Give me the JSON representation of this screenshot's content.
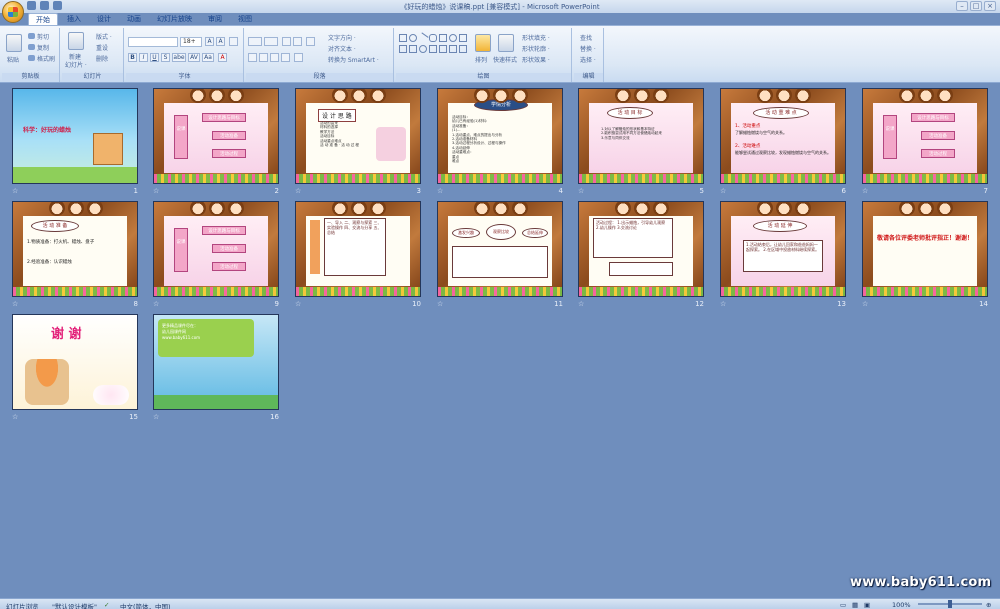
{
  "window": {
    "title": "《好玩的蜡烛》说课稿.ppt [兼容模式] - Microsoft PowerPoint",
    "controls": [
      "–",
      "□",
      "×"
    ]
  },
  "tabs": [
    "开始",
    "插入",
    "设计",
    "动画",
    "幻灯片放映",
    "审阅",
    "视图"
  ],
  "ribbon": {
    "clipboard": {
      "label": "剪贴板",
      "paste": "粘贴",
      "cut": "剪切",
      "copy": "复制",
      "format_painter": "格式刷"
    },
    "slides": {
      "label": "幻灯片",
      "new_slide": "新建",
      "new_slide2": "幻灯片 ·",
      "layout": "版式 ·",
      "reset": "重设",
      "delete": "删除"
    },
    "font": {
      "label": "字体",
      "size": "18+",
      "bold": "B",
      "italic": "I",
      "underline": "U",
      "strike": "S",
      "shadow": "abe",
      "spacing": "AV",
      "case": "Aa",
      "color": "A",
      "grow": "A",
      "shrink": "A"
    },
    "paragraph": {
      "label": "段落",
      "text_direction": "文字方向 ·",
      "align_text": "对齐文本 ·",
      "smartart": "转换为 SmartArt ·"
    },
    "drawing": {
      "label": "绘图",
      "arrange": "排列",
      "quick_styles": "快速样式",
      "fill": "形状填充 ·",
      "outline": "形状轮廓 ·",
      "effects": "形状效果 ·"
    },
    "editing": {
      "label": "编辑",
      "find": "查找",
      "replace": "替换 ·",
      "select": "选择 ·"
    }
  },
  "slides": [
    {
      "num": "1",
      "title": "科学：好玩的蜡烛"
    },
    {
      "num": "2",
      "side": "说课",
      "items": [
        "设计思路与目标",
        "活动准备",
        "活动过程"
      ]
    },
    {
      "num": "3",
      "title": "设 计 思 路",
      "lines": "活动的由来\n材料的选择\n教学方法\n活动目标\n活动重点难点\n活 动 准 备 · 活 动 过 程"
    },
    {
      "num": "4",
      "title": "学情分析",
      "lines": "活动目标：\n幼儿已有经验(1)材料：\n活动准备：\n(1)...\n1.活动重点、难点的提出与分析\n2.活动准备材料\n3.活动过程分析设计、过程与操作\n4.活动延伸\n活动重难点：\n重点\n难点"
    },
    {
      "num": "5",
      "title": "活 动 目 标",
      "lines": "1.对以了解蜡烛的形状和基本特征\n2.能积极尝试用不同方法使蜡烛动起来\n3.乐意与同伴交流"
    },
    {
      "num": "6",
      "title": "活 动 重 难 点",
      "h1": "1、活动重点",
      "t1": "了解蜡烛燃烧与空气的关系。",
      "h2": "2、活动难点",
      "t2": "能够尝试通过观察比较，发现蜡烛燃烧与空气的关系。"
    },
    {
      "num": "7",
      "side": "说课",
      "items": [
        "设计思路与目标",
        "活动准备",
        "活动过程"
      ]
    },
    {
      "num": "8",
      "title": "活 动 准 备",
      "t1": "1.物质准备：打火机、蜡烛、盘子",
      "t2": "2.经验准备：认识蜡烛"
    },
    {
      "num": "9",
      "side": "说课",
      "items": [
        "设计思路与目标",
        "活动准备",
        "活动过程"
      ]
    },
    {
      "num": "10",
      "lines": "一、导入\n二、观察与探索\n三、实验操作\n四、交流与分享\n五、总结"
    },
    {
      "num": "11",
      "flow": [
        "激发兴趣",
        "观察比较",
        "总结延伸"
      ]
    },
    {
      "num": "12",
      "lines": "活动过程：\n1.出示蜡烛，引导幼儿观察\n2.幼儿操作\n3.交流讨论"
    },
    {
      "num": "13",
      "title": "活 动 延 伸",
      "lines": "1.活动结束后，让幼儿回家和爸爸妈妈一起探索。\n2.在区域中投放材料继续探索。"
    },
    {
      "num": "14",
      "title": "敬请各位评委老师批评指正！谢谢！"
    },
    {
      "num": "15",
      "title": "谢 谢"
    },
    {
      "num": "16",
      "lines": "更多精品课件尽在：\n幼儿园课件网\nwww.baby611.com"
    }
  ],
  "status": {
    "view": "幻灯片浏览",
    "template": "\"默认设计模板\"",
    "language": "中文(简体，中国)",
    "zoom": "100%"
  },
  "watermark": "www.baby611.com",
  "colors": {
    "ribbon": "#dbe7f5",
    "sorter_bg": "#6f8ebd",
    "wood": "#8b4b1d"
  }
}
